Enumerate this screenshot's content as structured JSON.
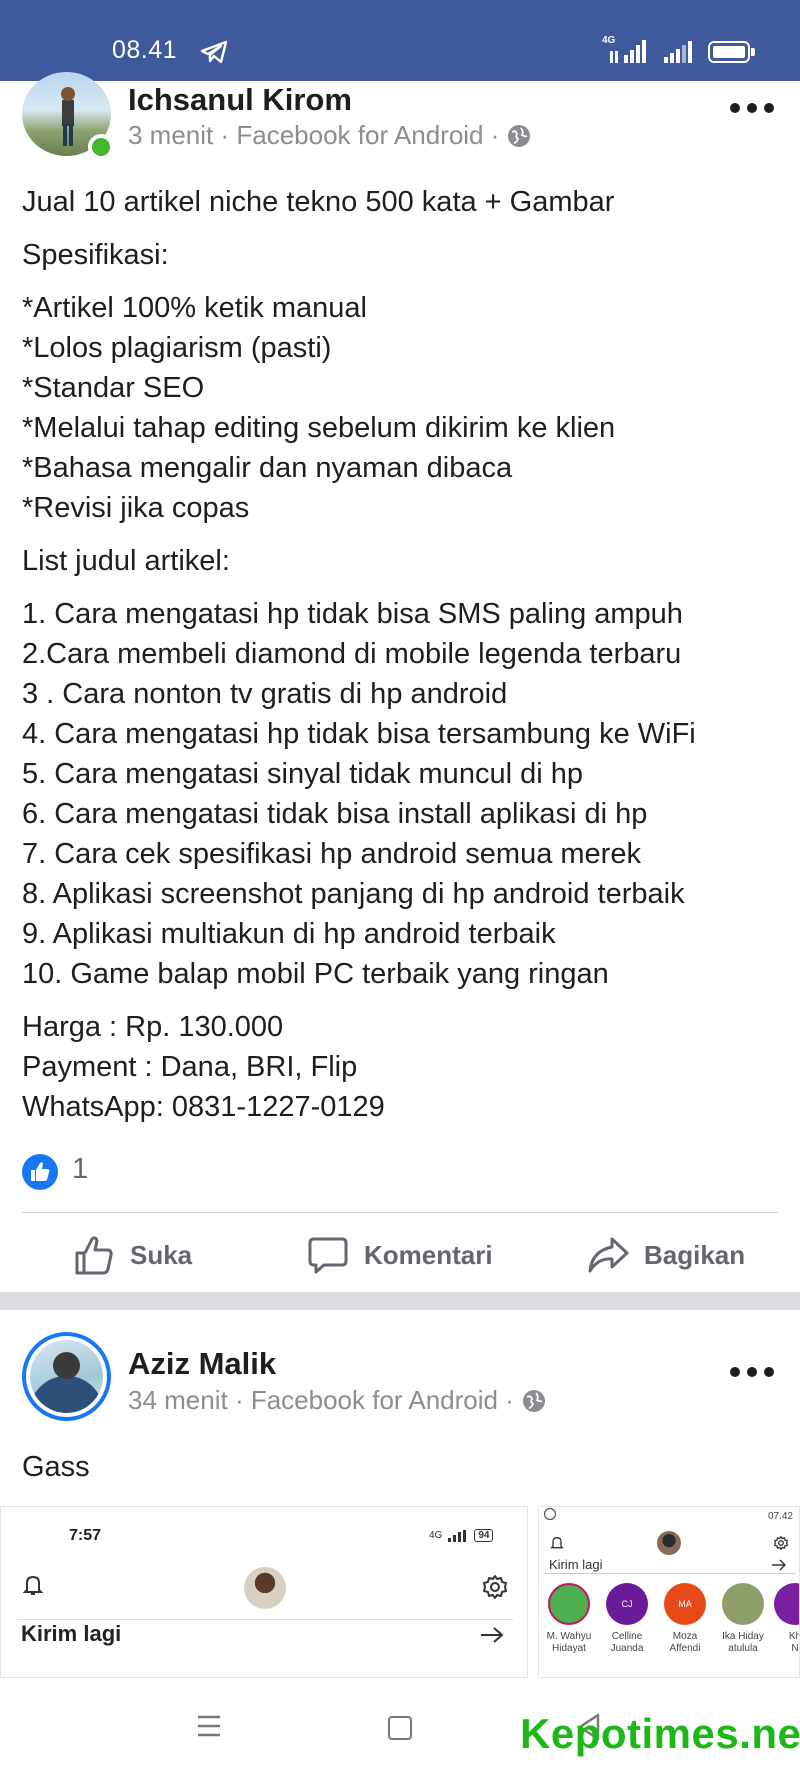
{
  "status_bar": {
    "time": "08.41",
    "network_label": "4G",
    "icons": [
      "telegram-icon",
      "signal-icon",
      "signal-icon",
      "battery-icon"
    ],
    "background": "#3f5a9c"
  },
  "post1": {
    "author": "Ichsanul Kirom",
    "meta": "3 menit · Facebook for Android ·",
    "online": true,
    "lines_group1": [
      "Jual 10 artikel niche tekno 500 kata + Gambar"
    ],
    "lines_group2": [
      "Spesifikasi:"
    ],
    "lines_group3": [
      "*Artikel 100% ketik manual",
      "*Lolos plagiarism (pasti)",
      "*Standar SEO",
      "*Melalui tahap editing sebelum dikirim ke klien",
      "*Bahasa mengalir dan nyaman dibaca",
      "*Revisi jika copas"
    ],
    "lines_group4": [
      "List judul artikel:"
    ],
    "lines_group5": [
      "1. Cara mengatasi hp tidak bisa SMS paling ampuh",
      "2.Cara membeli diamond di mobile legenda terbaru",
      "3 . Cara nonton tv gratis di hp android",
      "4. Cara mengatasi hp tidak bisa tersambung ke WiFi",
      "5. Cara mengatasi sinyal tidak muncul di hp",
      "6. Cara mengatasi tidak bisa install aplikasi di hp",
      "7. Cara cek spesifikasi hp android semua merek",
      "8. Aplikasi screenshot panjang di hp android terbaik",
      "9. Aplikasi multiakun di hp android terbaik",
      "10. Game balap mobil PC terbaik yang ringan"
    ],
    "lines_group6": [
      "Harga : Rp. 130.000",
      "Payment : Dana, BRI, Flip",
      "WhatsApp: 0831-1227-0129"
    ],
    "like_count": "1"
  },
  "actions": {
    "like": "Suka",
    "comment": "Komentari",
    "share": "Bagikan"
  },
  "post2": {
    "author": "Aziz Malik",
    "meta": "34 menit · Facebook for Android ·",
    "text": "Gass",
    "attachment1": {
      "time": "7:57",
      "network": "4G",
      "battery": "94",
      "title": "Kirim lagi"
    },
    "attachment2": {
      "time": "07.42",
      "title": "Kirim lagi",
      "contacts": [
        {
          "initials": "",
          "name1": "M. Wahyu",
          "name2": "Hidayat",
          "color": "#4caf50"
        },
        {
          "initials": "CJ",
          "name1": "Celline",
          "name2": "Juanda",
          "color": "#6a1b9a"
        },
        {
          "initials": "MA",
          "name1": "Moza",
          "name2": "Affendi",
          "color": "#e64a19"
        },
        {
          "initials": "",
          "name1": "Ika Hiday",
          "name2": "atulula",
          "color": "#8d9e6b"
        },
        {
          "initials": "",
          "name1": "Kh",
          "name2": "N",
          "color": "#7b1fa2"
        }
      ]
    }
  },
  "watermark": "Kepotimes.net",
  "colors": {
    "facebook_blue": "#1877f2",
    "online_green": "#42b72a",
    "watermark_green": "#1db817"
  }
}
